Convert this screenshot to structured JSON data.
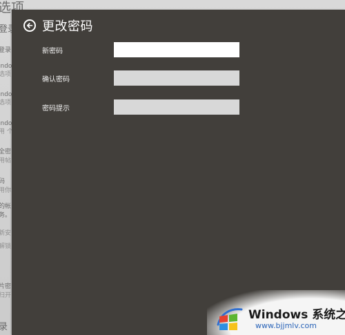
{
  "background": {
    "title": "选项",
    "items": [
      {
        "text": "登录",
        "style": "big"
      },
      {
        "text": "登录",
        "style": "normal"
      },
      {
        "text": "indo",
        "style": "normal"
      },
      {
        "text": "选项",
        "style": "sub"
      },
      {
        "text": "indo",
        "style": "normal"
      },
      {
        "text": "选项",
        "style": "sub"
      },
      {
        "text": "indo",
        "style": "normal"
      },
      {
        "text": "用 个",
        "style": "sub"
      },
      {
        "text": "全密",
        "style": "normal"
      },
      {
        "text": "用帖",
        "style": "sub"
      },
      {
        "text": "码",
        "style": "normal"
      },
      {
        "text": "用你",
        "style": "sub"
      },
      {
        "text": "的帐",
        "style": "normal"
      },
      {
        "text": "务。",
        "style": "normal"
      },
      {
        "text": "新安",
        "style": "sub"
      },
      {
        "text": "解锁",
        "style": "sub"
      },
      {
        "text": "片密",
        "style": "normal"
      },
      {
        "text": "扫开",
        "style": "sub"
      },
      {
        "text": "录",
        "style": "big"
      }
    ]
  },
  "flyout": {
    "title": "更改密码",
    "fields": [
      {
        "label": "新密码",
        "value": "",
        "state": "active"
      },
      {
        "label": "确认密码",
        "value": "",
        "state": "inactive"
      },
      {
        "label": "密码提示",
        "value": "",
        "state": "inactive"
      }
    ]
  },
  "watermark": {
    "brand": "Windows 系统之家",
    "site": "www.bjjmlv.com"
  },
  "icons": {
    "back": "back-arrow-icon",
    "logo": "windows-logo-icon"
  }
}
